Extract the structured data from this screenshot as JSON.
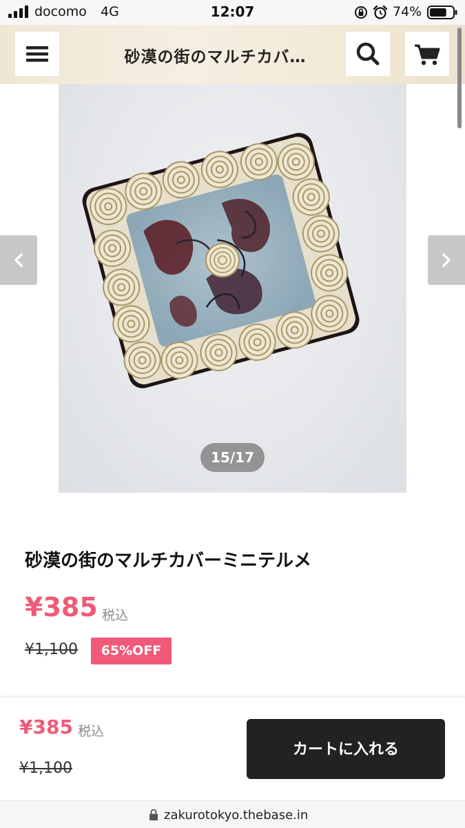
{
  "status_bar": {
    "carrier": "docomo",
    "network": "4G",
    "time": "12:07",
    "battery_percent": "74%",
    "battery_level": 0.74,
    "icons": [
      "signal-icon",
      "lock-rotation-icon",
      "alarm-icon",
      "battery-icon"
    ]
  },
  "header": {
    "title": "砂漠の街のマルチカバ…",
    "icons": [
      "menu-icon",
      "search-icon",
      "cart-icon"
    ]
  },
  "gallery": {
    "counter": "15/17",
    "current": 15,
    "total": 17,
    "icons": [
      "chevron-left-icon",
      "chevron-right-icon"
    ]
  },
  "product": {
    "name": "砂漠の街のマルチカバーミニテルメ",
    "price": "¥385",
    "tax_label": "税込",
    "original_price": "¥1,100",
    "discount": "65%OFF"
  },
  "bottom_bar": {
    "price": "¥385",
    "tax_label": "税込",
    "original_price": "¥1,100",
    "cart_button": "カートに入れる"
  },
  "url_bar": {
    "url": "zakurotokyo.thebase.in",
    "icon": "lock-icon"
  },
  "colors": {
    "accent": "#f05a78",
    "button_dark": "#222222",
    "header_bg": "#f2ead9"
  }
}
